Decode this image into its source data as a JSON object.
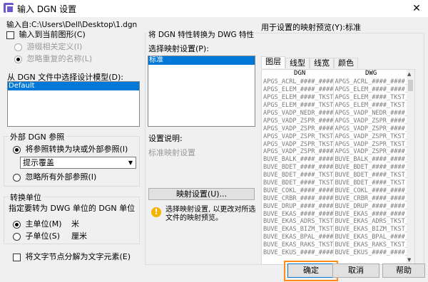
{
  "window": {
    "title": "输入 DGN 设置",
    "close_glyph": "✕"
  },
  "source": {
    "label": "输入自:",
    "path": "C:\\Users\\Dell\\Desktop\\1.dgn"
  },
  "options": {
    "insert_current": "输入到当前图形(C)",
    "ignore_defs": "游缀相关定义(I)",
    "ignore_dup": "忽略重复的名称(L)"
  },
  "model_section": {
    "label": "从 DGN 文件中选择设计模型(D):",
    "items": [
      "Default"
    ]
  },
  "xref": {
    "title": "外部 DGN 参照",
    "convert": "将参照转换为块或外部参照(I)",
    "dropdown_value": "提示覆盖",
    "ignore_all": "忽略所有外部参照(I)"
  },
  "units": {
    "title": "转换单位",
    "desc": "指定要转为 DWG 单位的 DGN 单位",
    "master": "主单位(M)",
    "master_value": "米",
    "sub": "子单位(S)",
    "sub_value": "厘米"
  },
  "explode_text": "将文字节点分解为文字元素(E)",
  "mapping": {
    "section_title": "将 DGN 特性转换为 DWG 特性",
    "select_label": "选择映射设置(P):",
    "items": [
      "标准"
    ],
    "desc_label": "设置说明:",
    "desc_text": "标准映射设置",
    "setup_button": "映射设置(U)...",
    "hint": "选择映射设置, 以更改对所选文件的映射预览。"
  },
  "preview": {
    "label": "用于设置的映射预览(Y):标准",
    "tabs": [
      "图层",
      "线型",
      "线宽",
      "颜色"
    ],
    "col_dgn": "DGN",
    "col_dwg": "DWG",
    "rows": [
      [
        "APGS_ACRL_####_####_#",
        "APGS_ACRL_####_####_#"
      ],
      [
        "APGS_ELEM_####_####_#",
        "APGS_ELEM_####_####_#"
      ],
      [
        "APGS_ELEM_####_TKST_#",
        "APGS_ELEM_####_TKST_#"
      ],
      [
        "APGS_ELEM_####_TKST...",
        "APGS_ELEM_####_TKST..."
      ],
      [
        "APGS_VADP_NEDR_####_#",
        "APGS_VADP_NEDR_####_#"
      ],
      [
        "APGS_VADP_ZSPR_####_#",
        "APGS_VADP_ZSPR_####_#"
      ],
      [
        "APGS_VADP_ZSPR_####_I",
        "APGS_VADP_ZSPR_####_I"
      ],
      [
        "APGS_VADP_ZSPR_TKST_#",
        "APGS_VADP_ZSPR_TKST_#"
      ],
      [
        "APGS_VADP_ZSPR_TKST_I",
        "APGS_VADP_ZSPR_TKST_I"
      ],
      [
        "APGS_VADP_ZSPR_####_#",
        "APGS_VADP_ZSPR_####_#"
      ],
      [
        "BUVE_BALK_####_####_#",
        "BUVE_BALK_####_####_#"
      ],
      [
        "BUVE_BDET_####_####_#",
        "BUVE_BDET_####_####_#"
      ],
      [
        "BUVE_BDET_####_TKST_#",
        "BUVE_BDET_####_TKST_#"
      ],
      [
        "BUVE_BDET_####_TKST...",
        "BUVE_BDET_####_TKST..."
      ],
      [
        "BUVE_COKL_####_####_#",
        "BUVE_COKL_####_####_#"
      ],
      [
        "BUVE_CRBR_####_####_#",
        "BUVE_CRBR_####_####_#"
      ],
      [
        "BUVE_DRUP_####_####_#",
        "BUVE_DRUP_####_####_#"
      ],
      [
        "BUVE_EKAS_####_####_#",
        "BUVE_EKAS_####_####_#"
      ],
      [
        "BUVE_EKAS_ADRS_TKST_#",
        "BUVE_EKAS_ADRS_TKST_#"
      ],
      [
        "BUVE_EKAS_BIZM_TKST_#",
        "BUVE_EKAS_BIZM_TKST_#"
      ],
      [
        "BUVE_EKAS_BPAL_####_#",
        "BUVE_EKAS_BPAL_####_#"
      ],
      [
        "BUVE_EKAS_RAKS_TKST_#",
        "BUVE_EKAS_RAKS_TKST_#"
      ],
      [
        "BUVE_EKUS_####_####_#",
        "BUVE_EKUS_####_####_#"
      ]
    ]
  },
  "buttons": {
    "ok": "确定",
    "cancel": "取消",
    "help": "帮助"
  }
}
